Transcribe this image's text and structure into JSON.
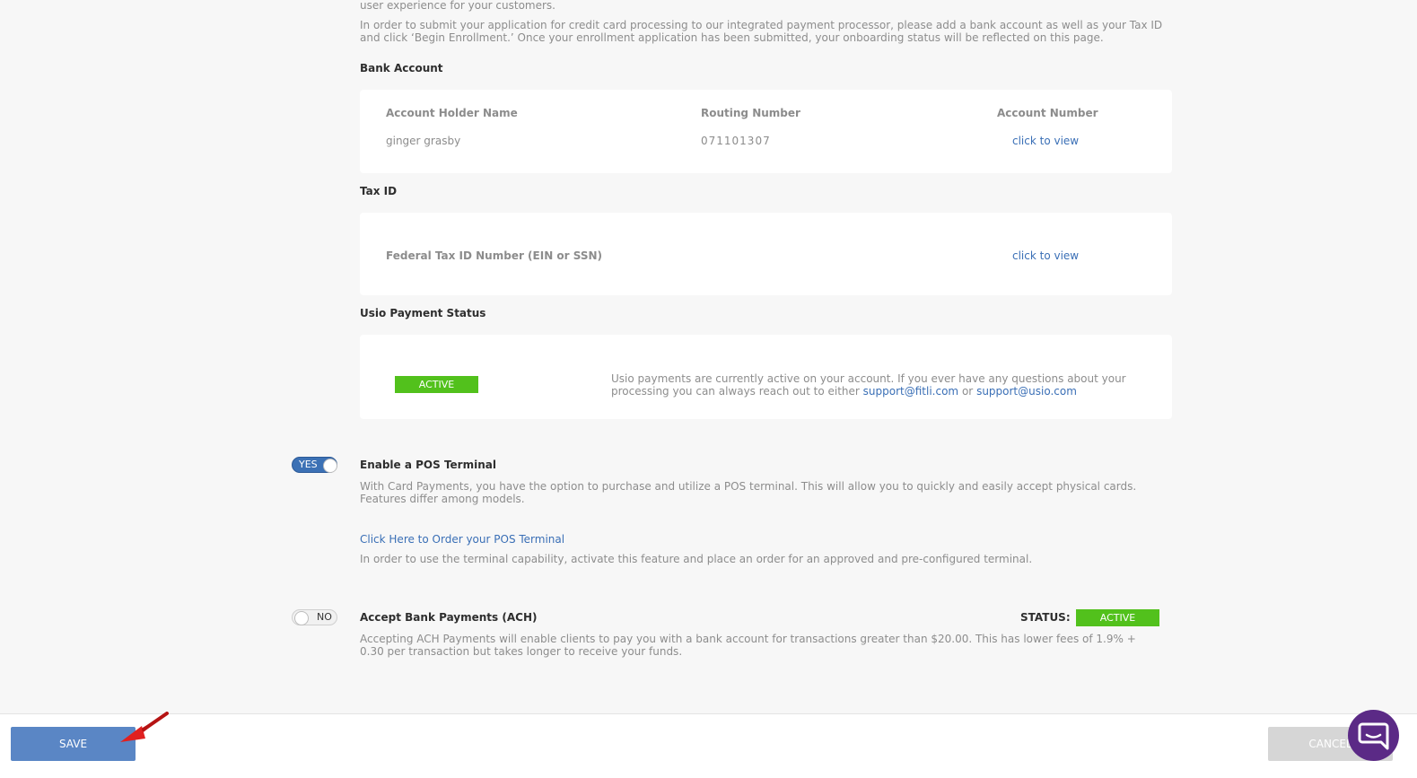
{
  "intro": {
    "line_top": "user experience for your customers.",
    "paragraph": "In order to submit your application for credit card processing to our integrated payment processor, please add a bank account as well as your Tax ID and click ‘Begin Enrollment.’ Once your enrollment application has been submitted, your onboarding status will be reflected on this page."
  },
  "bank_account": {
    "heading": "Bank Account",
    "headers": [
      "Account Holder Name",
      "Routing Number",
      "Account Number"
    ],
    "holder_name": "ginger grasby",
    "routing_number": "071101307",
    "account_number_link": "click to view"
  },
  "tax_id": {
    "heading": "Tax ID",
    "label": "Federal Tax ID Number (EIN or SSN)",
    "link": "click to view"
  },
  "usio_status": {
    "heading": "Usio Payment Status",
    "badge": "ACTIVE",
    "text_prefix": "Usio payments are currently active on your account. If you ever have any questions about your processing you can always reach out to either",
    "email1": "support@fitli.com",
    "or": "or",
    "email2": "support@usio.com"
  },
  "pos": {
    "toggle_label": "YES",
    "toggle_on": true,
    "title": "Enable a POS Terminal",
    "description": "With Card Payments, you have the option to purchase and utilize a POS terminal. This will allow you to quickly and easily accept physical cards. Features differ among models.",
    "order_link": "Click Here to Order your POS Terminal",
    "note": "In order to use the terminal capability, activate this feature and place an order for an approved and pre-configured terminal."
  },
  "ach": {
    "toggle_label": "NO",
    "toggle_on": false,
    "title": "Accept Bank Payments (ACH)",
    "status_label": "STATUS:",
    "status_badge": "ACTIVE",
    "description": "Accepting ACH Payments will enable clients to pay you with a bank account for transactions greater than $20.00. This has lower fees of 1.9% + 0.30 per transaction but takes longer to receive your funds."
  },
  "footer": {
    "save_label": "SAVE",
    "cancel_label": "CANCEL"
  },
  "colors": {
    "accent": "#3c71b5",
    "active_green": "#52c11c",
    "link": "#3a6fb6",
    "chat_purple": "#5b2a86"
  },
  "icons": {
    "chat": "chat-bubble-icon",
    "arrow": "red-arrow-annotation-icon"
  }
}
